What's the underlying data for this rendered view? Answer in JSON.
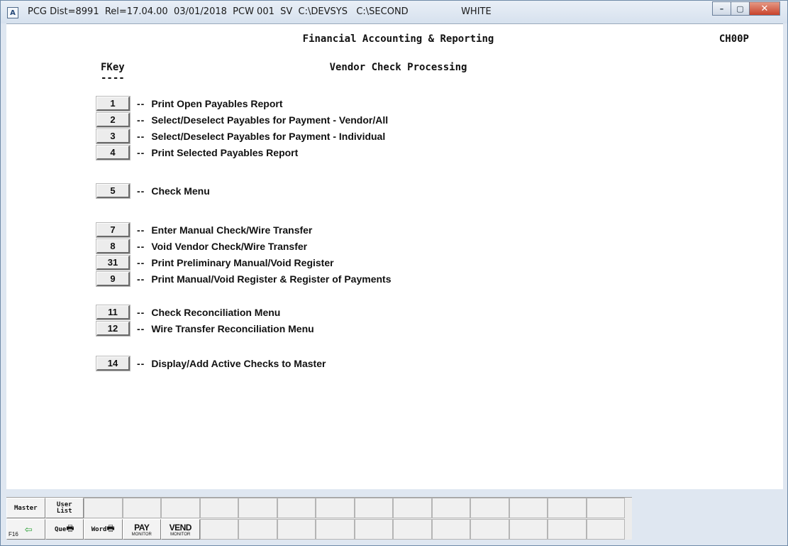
{
  "window": {
    "icon_letter": "A",
    "title": "PCG Dist=8991  Rel=17.04.00  03/01/2018  PCW 001  SV  C:\\DEVSYS   C:\\SECOND                  WHITE",
    "minimize_glyph": "–",
    "maximize_glyph": "▢",
    "close_glyph": "✕"
  },
  "screen": {
    "title": "Financial Accounting & Reporting",
    "code": "CH00P",
    "fkey_header": "FKey",
    "fkey_rule": "----",
    "menu_title": "Vendor Check Processing",
    "separator": "--",
    "items": [
      {
        "key": "1",
        "label": "Print Open Payables Report"
      },
      {
        "key": "2",
        "label": "Select/Deselect Payables for Payment - Vendor/All"
      },
      {
        "key": "3",
        "label": "Select/Deselect Payables for Payment - Individual"
      },
      {
        "key": "4",
        "label": "Print Selected Payables Report"
      },
      {
        "key": "5",
        "label": "Check Menu"
      },
      {
        "key": "7",
        "label": "Enter Manual Check/Wire Transfer"
      },
      {
        "key": "8",
        "label": "Void Vendor Check/Wire Transfer"
      },
      {
        "key": "31",
        "label": "Print Preliminary Manual/Void Register"
      },
      {
        "key": "9",
        "label": "Print Manual/Void Register & Register of Payments"
      },
      {
        "key": "11",
        "label": "Check Reconciliation Menu"
      },
      {
        "key": "12",
        "label": "Wire Transfer Reconciliation Menu"
      },
      {
        "key": "14",
        "label": "Display/Add Active Checks to Master"
      }
    ]
  },
  "toolbar": {
    "master_label": "Master",
    "userlist_top": "User",
    "userlist_bottom": "List",
    "f16_label": "F16",
    "que_label": "Que",
    "word_label": "Word",
    "pay_big": "PAY",
    "pay_small": "MONITOR",
    "vend_big": "VEND",
    "vend_small": "MONITOR"
  },
  "icons": {
    "back_arrow": "back-arrow-icon",
    "printer": "printer-icon"
  }
}
